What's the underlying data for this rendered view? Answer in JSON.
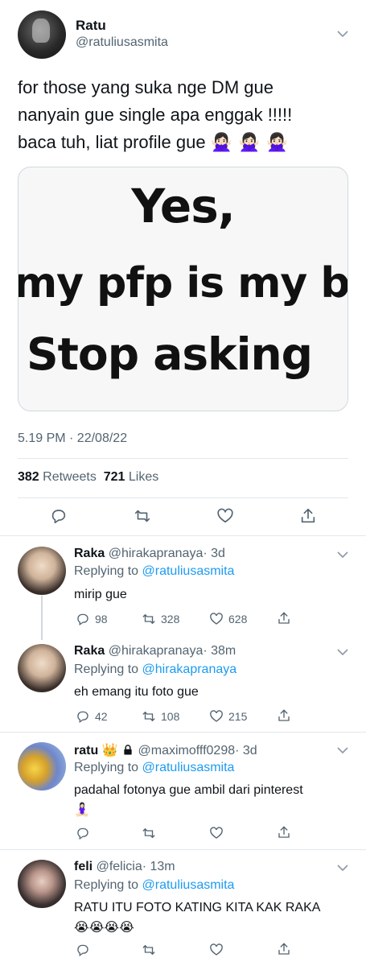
{
  "tweet": {
    "name": "Ratu",
    "handle": "@ratuliusasmita",
    "text_line1": "for those yang suka nge DM gue",
    "text_line2": "nanyain gue single apa enggak !!!!!",
    "text_line3": "baca tuh, liat profile gue",
    "text_emojis": "🙅🏻‍♀️ 🙅🏻‍♀️ 🙅🏻‍♀️",
    "media": {
      "line1": "Yes,",
      "line2": "my pfp is my bf",
      "line3": "Stop asking"
    },
    "timestamp": "5.19 PM · 22/08/22",
    "retweets_count": "382",
    "retweets_label": "Retweets",
    "likes_count": "721",
    "likes_label": "Likes"
  },
  "replies": [
    {
      "name": "Raka",
      "handle": "@hirakapranaya",
      "time": "· 3d",
      "replying_prefix": "Replying to",
      "replying_to": "@ratuliusasmita",
      "text": "mirip gue",
      "reply_count": "98",
      "retweet_count": "328",
      "like_count": "628"
    },
    {
      "name": "Raka",
      "handle": "@hirakapranaya",
      "time": "· 38m",
      "replying_prefix": "Replying to",
      "replying_to": "@hirakapranaya",
      "text": "eh emang itu foto gue",
      "reply_count": "42",
      "retweet_count": "108",
      "like_count": "215"
    },
    {
      "name": "ratu",
      "name_emoji": "👑",
      "handle": "@maximofff0298",
      "time": "· 3d",
      "replying_prefix": "Replying to",
      "replying_to": "@ratuliusasmita",
      "text": "padahal fotonya gue ambil dari pinterest",
      "text_emoji": "🧘🏻‍♀️"
    },
    {
      "name": "feli",
      "handle": "@felicia",
      "time": "· 13m",
      "replying_prefix": "Replying to",
      "replying_to": "@ratuliusasmita",
      "text": "RATU ITU FOTO KATING KITA KAK RAKA",
      "text_emoji": "😭😭😭😭"
    }
  ],
  "colors": {
    "link": "#1d9bf0",
    "secondary_text": "#536471",
    "divider": "#e1e8ed"
  }
}
